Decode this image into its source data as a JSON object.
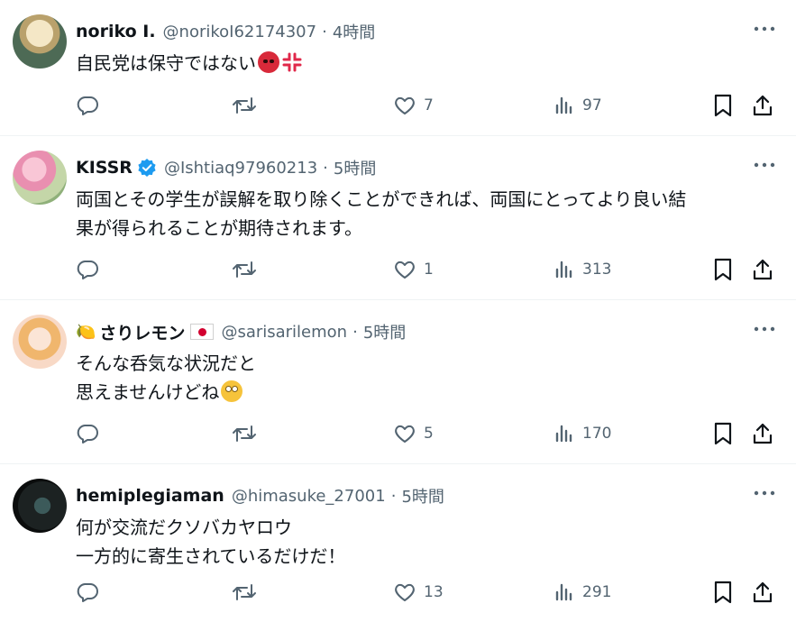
{
  "tweets": [
    {
      "name": "noriko I.",
      "handle": "@norikoI62174307",
      "separator": "·",
      "time": "4時間",
      "text": "自民党は保守ではない",
      "emojis": [
        "angry-face-emoji",
        "anger-symbol-emoji"
      ],
      "reply_count": "",
      "retweet_count": "",
      "like_count": "7",
      "view_count": "97"
    },
    {
      "name": "KISSR",
      "verified": true,
      "handle": "@Ishtiaq97960213",
      "separator": "·",
      "time": "5時間",
      "text": "両国とその学生が誤解を取り除くことができれば、両国にとってより良い結\n果が得られることが期待されます。",
      "reply_count": "",
      "retweet_count": "",
      "like_count": "1",
      "view_count": "313"
    },
    {
      "name": "さりレモン",
      "name_prefix_emoji": "🍋",
      "name_suffix_emoji": "japan-flag",
      "handle": "@sarisarilemon",
      "separator": "·",
      "time": "5時間",
      "text_line1": "そんな呑気な状況だと",
      "text_line2": "思えませんけどね",
      "emojis": [
        "face-with-rolling-eyes-emoji"
      ],
      "reply_count": "",
      "retweet_count": "",
      "like_count": "5",
      "view_count": "170"
    },
    {
      "name": "hemiplegiaman",
      "handle": "@himasuke_27001",
      "separator": "·",
      "time": "5時間",
      "text": "何が交流だクソバカヤロウ\n一方的に寄生されているだけだ！",
      "reply_count": "",
      "retweet_count": "",
      "like_count": "13",
      "view_count": "291"
    }
  ],
  "icons": {
    "reply": "reply-icon",
    "retweet": "retweet-icon",
    "like": "heart-icon",
    "views": "views-icon",
    "bookmark": "bookmark-icon",
    "share": "share-icon",
    "more": "more-icon"
  },
  "colors": {
    "text": "#0f1419",
    "secondary": "#536471",
    "verified": "#1d9bf0",
    "divider": "#eff3f4"
  }
}
